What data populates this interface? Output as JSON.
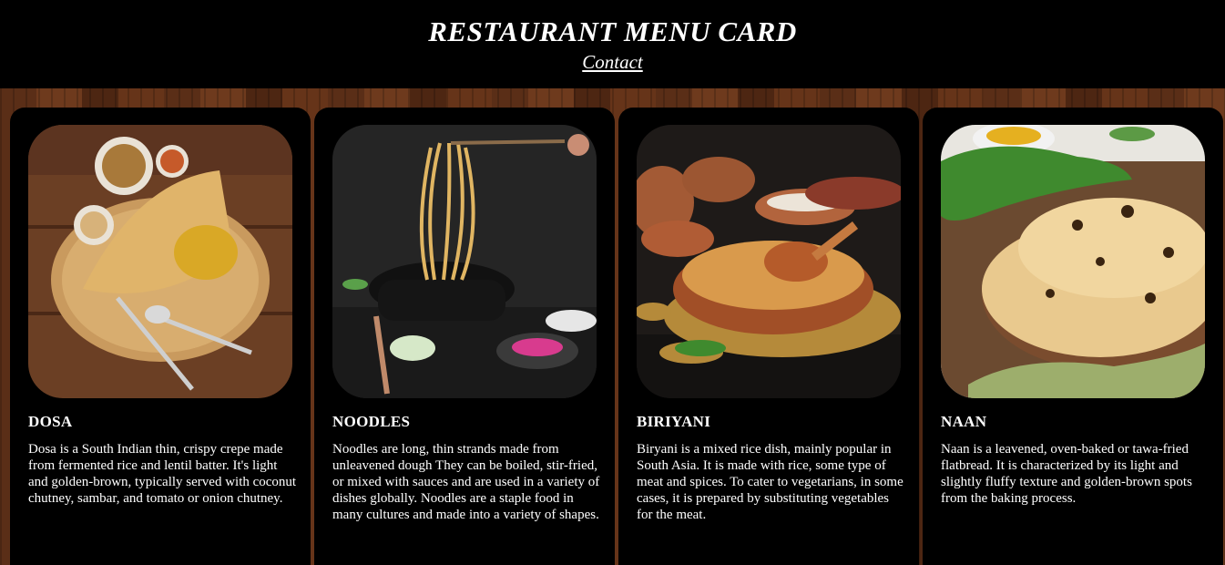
{
  "header": {
    "title": "RESTAURANT MENU CARD",
    "contact_link": "Contact"
  },
  "menu": [
    {
      "name": "DOSA",
      "image_icon": "dosa-photo",
      "description": "Dosa is a South Indian thin, crispy crepe made from fermented rice and lentil batter. It's light and golden-brown, typically served with coconut chutney, sambar, and tomato or onion chutney."
    },
    {
      "name": "NOODLES",
      "image_icon": "noodles-photo",
      "description": "Noodles are long, thin strands made from unleavened dough They can be boiled, stir-fried, or mixed with sauces and are used in a variety of dishes globally. Noodles are a staple food in many cultures and made into a variety of shapes."
    },
    {
      "name": "BIRIYANI",
      "image_icon": "biriyani-photo",
      "description": "Biryani is a mixed rice dish, mainly popular in South Asia. It is made with rice, some type of meat and spices. To cater to vegetarians, in some cases, it is prepared by substituting vegetables for the meat."
    },
    {
      "name": "NAAN",
      "image_icon": "naan-photo",
      "description": "Naan is a leavened, oven-baked or tawa-fried flatbread. It is characterized by its light and slightly fluffy texture and golden-brown spots from the baking process."
    }
  ]
}
